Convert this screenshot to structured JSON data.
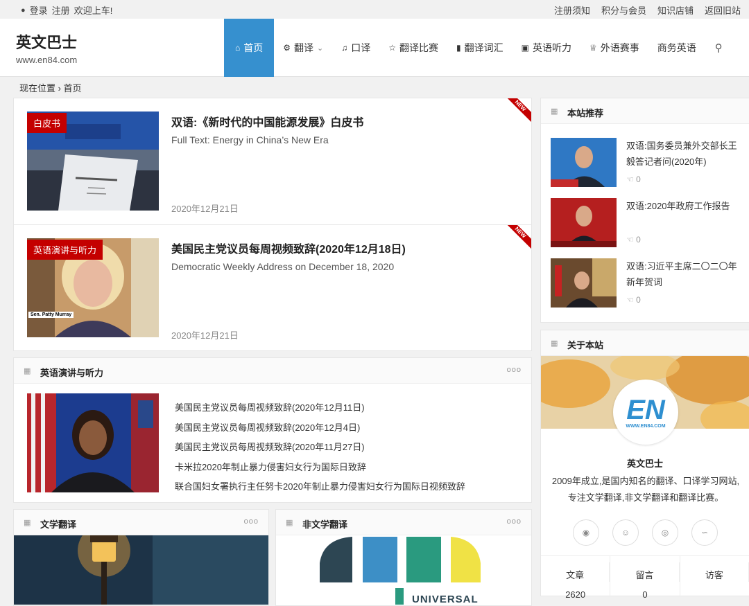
{
  "topbar": {
    "user_icon": "user-icon",
    "login": "登录",
    "register": "注册",
    "welcome": "欢迎上车!",
    "links": [
      "注册须知",
      "积分与会员",
      "知识店铺",
      "返回旧站"
    ]
  },
  "site": {
    "name": "英文巴士",
    "url": "www.en84.com"
  },
  "nav": {
    "items": [
      {
        "icon": "⌂",
        "label": "首页",
        "icon_name": "home-icon"
      },
      {
        "icon": "⚙",
        "label": "翻译",
        "icon_name": "gears-icon",
        "caret": "⌄"
      },
      {
        "icon": "♫",
        "label": "口译",
        "icon_name": "headphones-icon"
      },
      {
        "icon": "☆",
        "label": "翻译比赛",
        "icon_name": "star-icon"
      },
      {
        "icon": "▮",
        "label": "翻译词汇",
        "icon_name": "book-icon"
      },
      {
        "icon": "▣",
        "label": "英语听力",
        "icon_name": "play-icon"
      },
      {
        "icon": "♕",
        "label": "外语赛事",
        "icon_name": "trophy-icon"
      },
      {
        "icon": "",
        "label": "商务英语",
        "icon_name": ""
      }
    ],
    "search_icon": "⚲"
  },
  "breadcrumb": "现在位置 › 首页",
  "posts": [
    {
      "tag": "白皮书",
      "title": "双语:《新时代的中国能源发展》白皮书",
      "subtitle": "Full Text: Energy in China’s New Era",
      "date": "2020年12月21日",
      "badge": "NEW"
    },
    {
      "tag": "英语演讲与听力",
      "title": "美国民主党议员每周视频致辞(2020年12月18日)",
      "subtitle": "Democratic Weekly Address on December 18, 2020",
      "date": "2020年12月21日",
      "badge": "NEW",
      "caption": "Sen. Patty Murray"
    }
  ],
  "speech_block": {
    "title": "英语演讲与听力",
    "more": "ooo",
    "items": [
      "美国民主党议员每周视频致辞(2020年12月11日)",
      "美国民主党议员每周视频致辞(2020年12月4日)",
      "美国民主党议员每周视频致辞(2020年11月27日)",
      "卡米拉2020年制止暴力侵害妇女行为国际日致辞",
      "联合国妇女署执行主任努卡2020年制止暴力侵害妇女行为国际日视频致辞"
    ]
  },
  "lit_block": {
    "title": "文学翻译",
    "more": "ooo"
  },
  "nonlit_block": {
    "title": "非文学翻译",
    "more": "ooo",
    "logo_text": "UNIVERSAL"
  },
  "recommend": {
    "title": "本站推荐",
    "items": [
      {
        "text": "双语:国务委员兼外交部长王毅答记者问(2020年)",
        "likes": "0"
      },
      {
        "text": "双语:2020年政府工作报告",
        "likes": "0"
      },
      {
        "text": "双语:习近平主席二〇二〇年新年贺词",
        "likes": "0"
      }
    ]
  },
  "about": {
    "title": "关于本站",
    "logo_main": "EN",
    "logo_sub": "WWW.EN84.COM",
    "name": "英文巴士",
    "desc": "2009年成立,是国内知名的翻译、口译学习网站,专注文学翻译,非文学翻译和翻译比赛。",
    "stats": [
      {
        "label": "文章",
        "value": "2620"
      },
      {
        "label": "留言",
        "value": "0"
      },
      {
        "label": "访客",
        "value": ""
      }
    ]
  }
}
